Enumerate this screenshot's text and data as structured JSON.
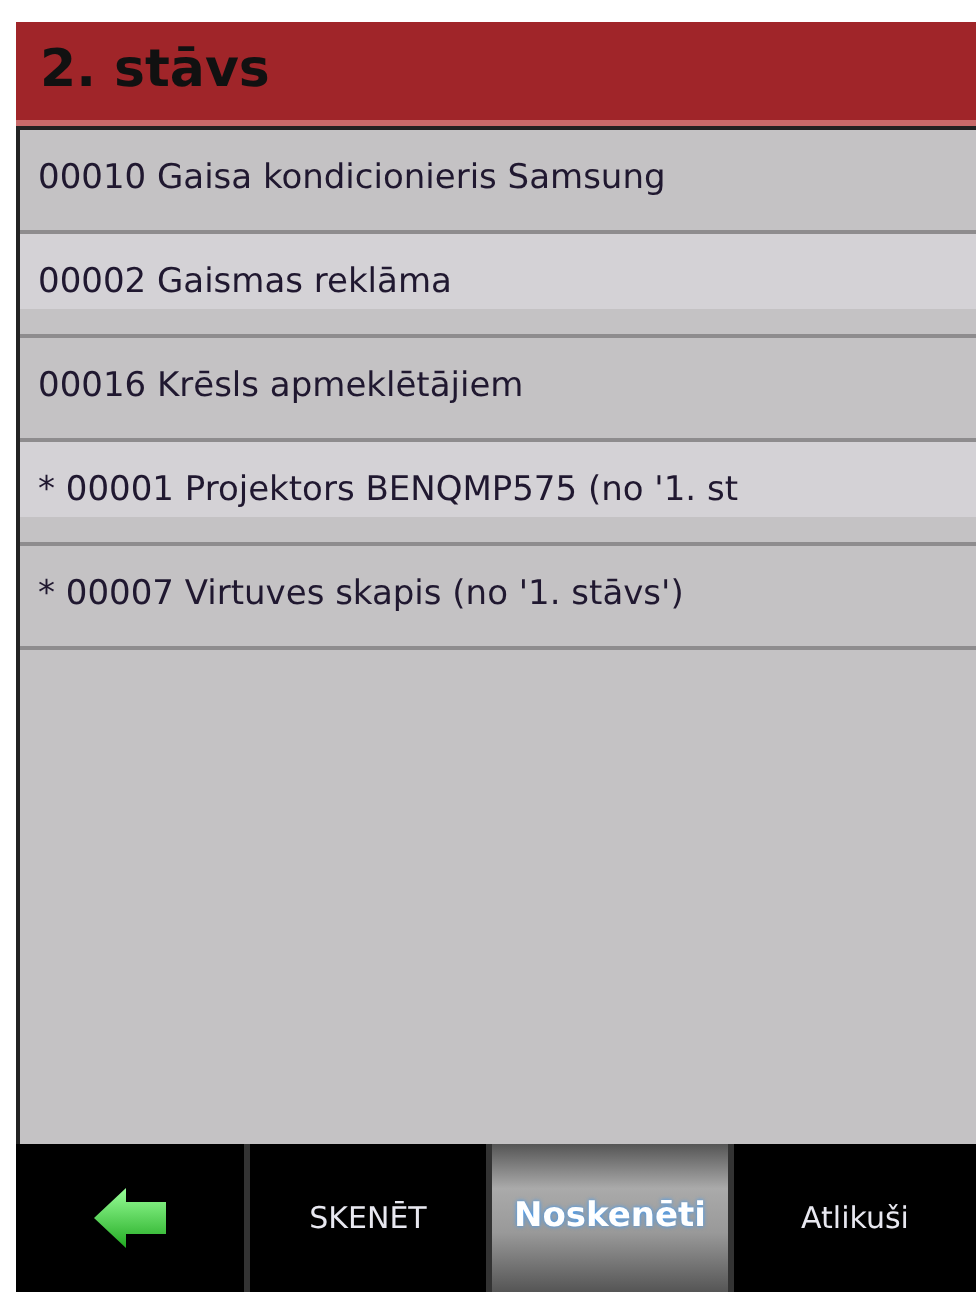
{
  "header": {
    "title": "2. stāvs"
  },
  "items": [
    "00010 Gaisa kondicionieris Samsung",
    "00002 Gaismas reklāma",
    "00016 Krēsls apmeklētājiem",
    "* 00001 Projektors BENQMP575 (no '1. st",
    "* 00007 Virtuves skapis (no '1. stāvs')"
  ],
  "tabs": [
    {
      "label": "SKENĒT",
      "selected": false
    },
    {
      "label": "Noskenēti",
      "selected": true
    },
    {
      "label": "Atlikuši",
      "selected": false
    }
  ]
}
